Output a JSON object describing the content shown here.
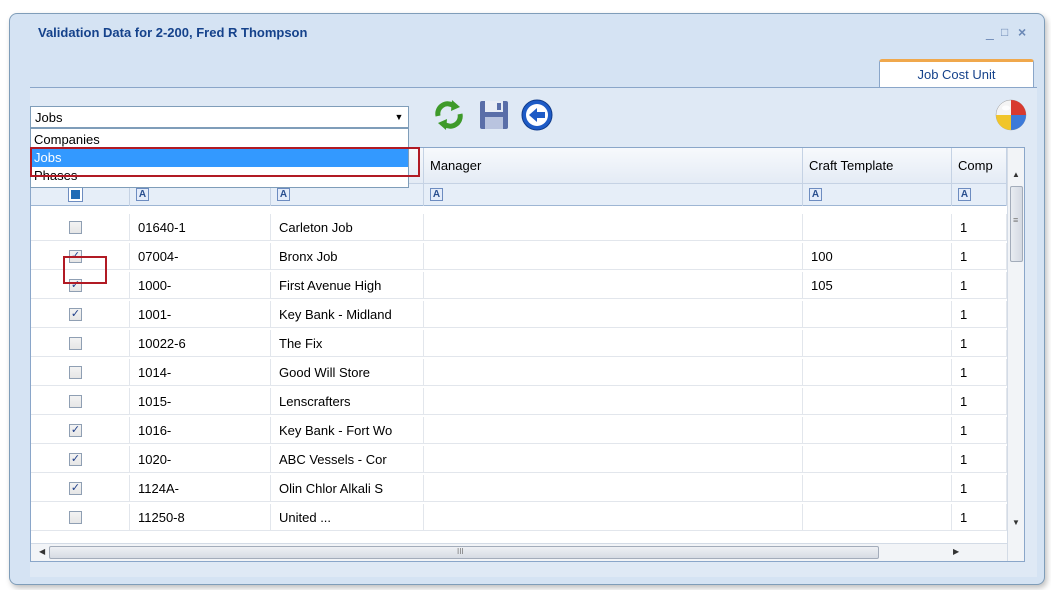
{
  "window": {
    "title": "Validation Data for 2-200, Fred R Thompson",
    "minimize_glyph": "_",
    "maximize_glyph": "□",
    "close_glyph": "×"
  },
  "tabs": [
    {
      "label": "Job Cost Unit"
    }
  ],
  "combo": {
    "value": "Jobs",
    "arrow_glyph": "▼",
    "options": [
      "Companies",
      "Jobs",
      "Phases"
    ],
    "selected": "Jobs"
  },
  "toolbar": {
    "icons": [
      "refresh-icon",
      "save-icon",
      "back-arrow-icon",
      "beach-ball-icon"
    ]
  },
  "grid": {
    "columns": [
      "",
      "",
      "",
      "Manager",
      "Craft Template",
      "Comp"
    ],
    "filter_glyph": "A",
    "rows": [
      {
        "checked": false,
        "job": "01640-1",
        "description": "Carleton Job",
        "manager": "",
        "craft": "",
        "comp": "1"
      },
      {
        "checked": true,
        "job": "07004-",
        "description": "Bronx Job",
        "manager": "",
        "craft": "100",
        "comp": "1"
      },
      {
        "checked": true,
        "job": "1000-",
        "description": "First Avenue High",
        "manager": "",
        "craft": "105",
        "comp": "1"
      },
      {
        "checked": true,
        "job": "1001-",
        "description": "Key Bank - Midland",
        "manager": "",
        "craft": "",
        "comp": "1"
      },
      {
        "checked": false,
        "job": "10022-6",
        "description": "The Fix",
        "manager": "",
        "craft": "",
        "comp": "1"
      },
      {
        "checked": false,
        "job": "1014-",
        "description": "Good Will Store",
        "manager": "",
        "craft": "",
        "comp": "1"
      },
      {
        "checked": false,
        "job": "1015-",
        "description": "Lenscrafters",
        "manager": "",
        "craft": "",
        "comp": "1"
      },
      {
        "checked": true,
        "job": "1016-",
        "description": "Key Bank - Fort Wo",
        "manager": "",
        "craft": "",
        "comp": "1"
      },
      {
        "checked": true,
        "job": "1020-",
        "description": "ABC Vessels - Cor",
        "manager": "",
        "craft": "",
        "comp": "1"
      },
      {
        "checked": true,
        "job": "1124A-",
        "description": "Olin Chlor Alkali S",
        "manager": "",
        "craft": "",
        "comp": "1"
      },
      {
        "checked": false,
        "job": "11250-8",
        "description": "United ...",
        "manager": "",
        "craft": "",
        "comp": "1"
      }
    ],
    "check_glyph": "✓",
    "scroll_glyphs": {
      "up": "▲",
      "down": "▼",
      "left": "◀",
      "right": "▶",
      "grip": "III",
      "v_grip": "≡"
    }
  },
  "colors": {
    "selection": "#3399ff",
    "highlight_outline": "#b11a24",
    "tab_accent": "#f0a84c",
    "title_text": "#15428b"
  }
}
